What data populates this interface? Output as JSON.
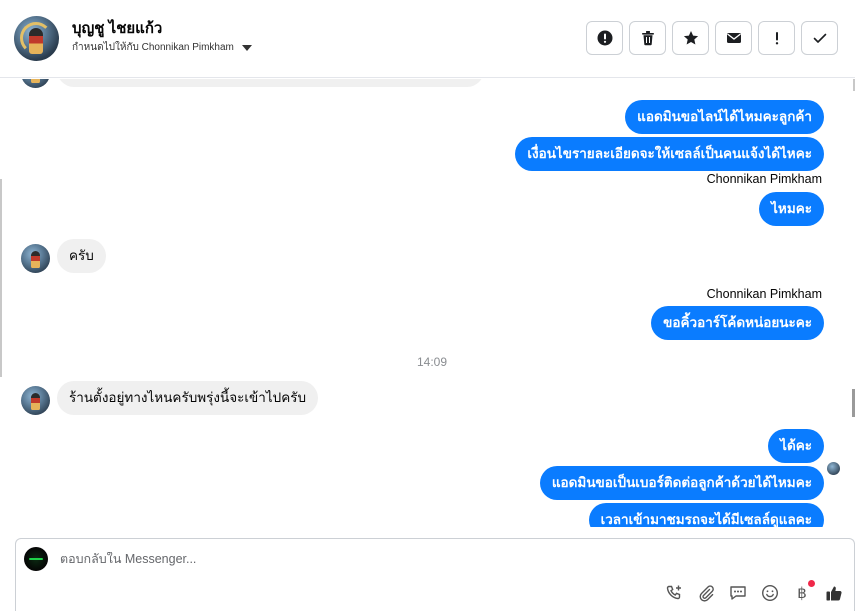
{
  "header": {
    "contact_name": "บุญชู ไชยแก้ว",
    "assigned_label": "กำหนดไปให้กับ Chonnikan Pimkham",
    "actions": [
      {
        "name": "spam-button",
        "icon": "alert-circle-icon"
      },
      {
        "name": "delete-button",
        "icon": "trash-icon"
      },
      {
        "name": "star-button",
        "icon": "star-icon"
      },
      {
        "name": "mark-unread-button",
        "icon": "envelope-icon"
      },
      {
        "name": "follow-up-button",
        "icon": "exclamation-icon"
      },
      {
        "name": "mark-done-button",
        "icon": "check-icon"
      }
    ]
  },
  "messages": {
    "out_1": "แอดมินขอไลน์ได้ไหมคะลูกค้า",
    "out_2": "เงื่อนไขรายละเอียดจะให้เซลล์เป็นคนแจ้งได้ไหคะ",
    "sender_1": "Chonnikan Pimkham",
    "out_3": "ไหมคะ",
    "in_1": "ครับ",
    "sender_2": "Chonnikan Pimkham",
    "out_4": "ขอคิ้วอาร์โค้ดหน่อยนะคะ",
    "time_1": "14:09",
    "in_2": "ร้านตั้งอยู่ทางไหนครับพรุ่งนี้จะเข้าไปครับ",
    "out_5": "ได้คะ",
    "out_6": "แอดมินขอเป็นเบอร์ติดต่อลูกค้าด้วยได้ไหมคะ",
    "out_7": "เวลาเข้ามาชมรถจะได้มีเซลล์ดูแลคะ"
  },
  "composer": {
    "placeholder": "ตอบกลับใน Messenger...",
    "tools": [
      "add-call-icon",
      "attachment-icon",
      "saved-reply-icon",
      "emoji-icon",
      "baht-payment-icon",
      "like-icon"
    ],
    "baht_symbol": "฿"
  },
  "colors": {
    "outgoing_bubble": "#0a7cff",
    "incoming_bubble": "#f0f0f0",
    "notification_dot": "#f02849"
  }
}
